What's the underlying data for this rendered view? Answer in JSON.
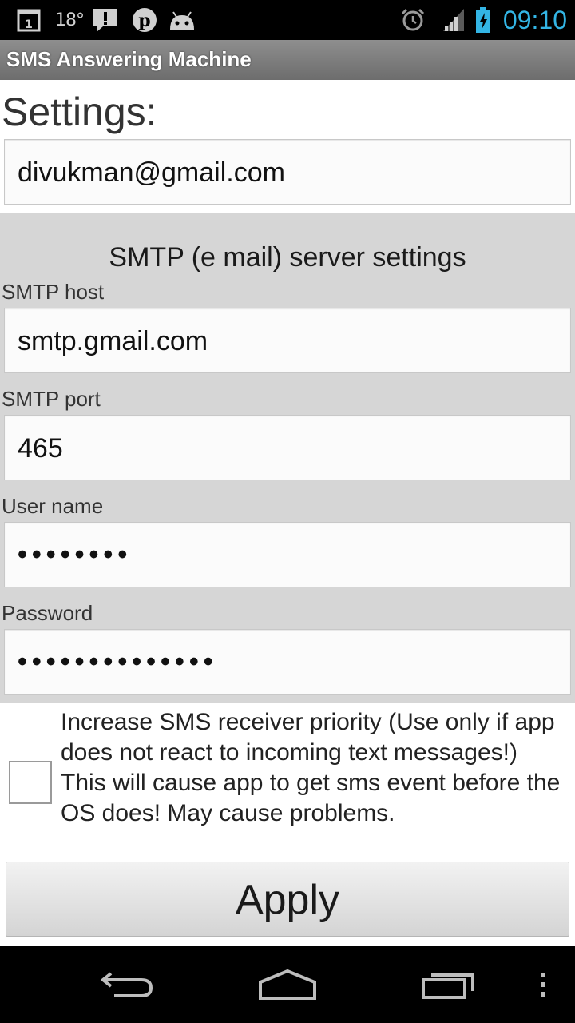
{
  "status_bar": {
    "temperature": "18°",
    "time": "09:10",
    "icons": [
      "calendar-icon",
      "temperature-icon",
      "alert-icon",
      "pinterest-icon",
      "android-icon",
      "alarm-icon",
      "signal-icon",
      "battery-charging-icon"
    ],
    "time_color": "#33b5e5"
  },
  "app": {
    "title": "SMS Answering Machine"
  },
  "settings": {
    "heading": "Settings:",
    "email_value": "divukman@gmail.com"
  },
  "smtp": {
    "heading": "SMTP (e mail) server settings",
    "host_label": "SMTP host",
    "host_value": "smtp.gmail.com",
    "port_label": "SMTP port",
    "port_value": "465",
    "username_label": "User name",
    "username_value": "••••••••",
    "password_label": "Password",
    "password_value": "••••••••••••••"
  },
  "priority": {
    "checked": false,
    "label": "Increase SMS receiver priority (Use only if app does not react to incoming text messages!) This will cause app to get sms event before the OS does! May cause problems."
  },
  "actions": {
    "apply_label": "Apply"
  },
  "nav_bar": {
    "icons": [
      "back-icon",
      "home-icon",
      "recent-apps-icon",
      "menu-icon"
    ]
  }
}
